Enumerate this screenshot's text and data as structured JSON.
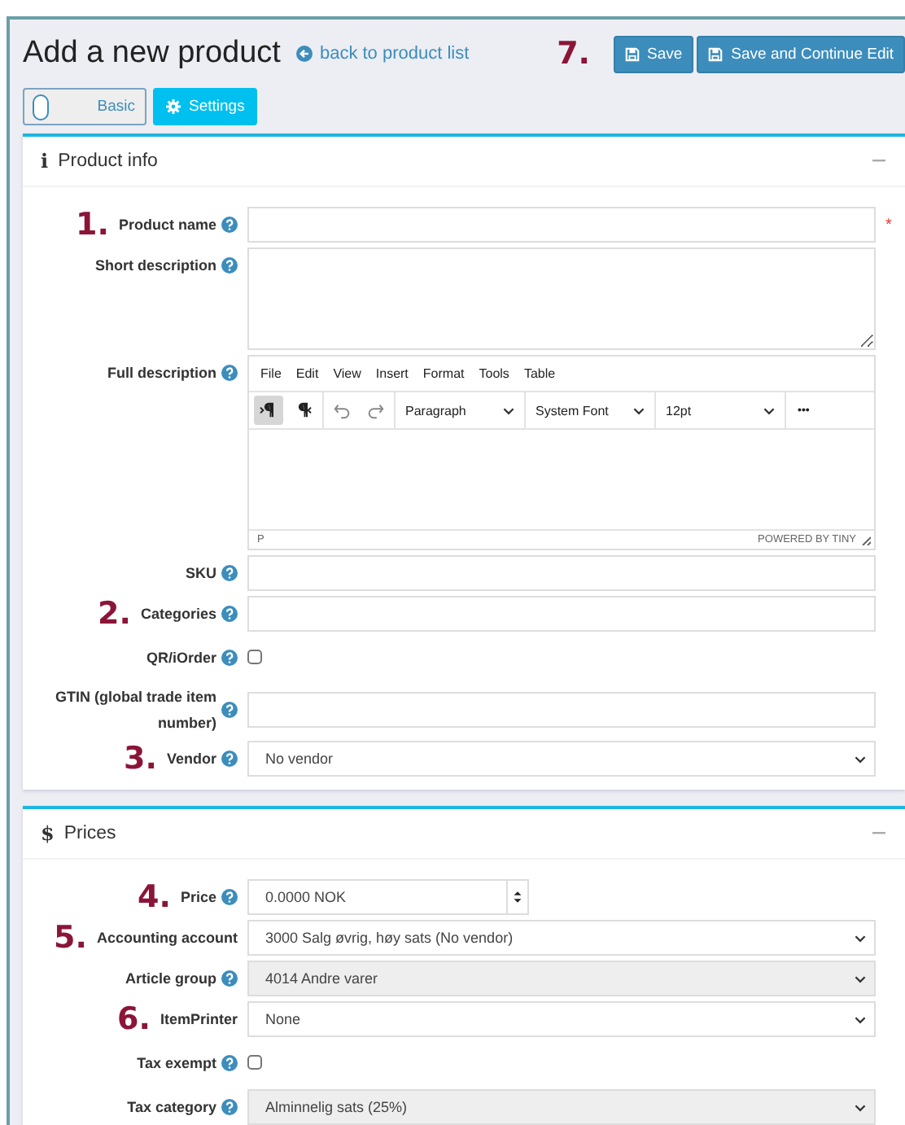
{
  "header": {
    "title": "Add a new product",
    "back_link": "back to product list",
    "marker": "7.",
    "buttons": [
      "Save",
      "Save and Continue Edit"
    ]
  },
  "mode_switch": {
    "label": "Basic",
    "on": false
  },
  "settings_button": "Settings",
  "sections": [
    {
      "icon": "i",
      "title": "Product info",
      "fields": [
        {
          "kind": "text",
          "label": "Product name",
          "marker": "1.",
          "help": true,
          "required_mark": "*"
        },
        {
          "kind": "textarea",
          "label": "Short description",
          "help": true
        },
        {
          "kind": "editor",
          "label": "Full description",
          "help": true,
          "menu": [
            "File",
            "Edit",
            "View",
            "Insert",
            "Format",
            "Tools",
            "Table"
          ],
          "direction_buttons": [
            {
              "selected": true
            },
            {
              "selected": false
            }
          ],
          "dropdowns": [
            "Paragraph",
            "System Font",
            "12pt"
          ],
          "more": "•••",
          "status_path": "P",
          "branding": "POWERED BY TINY"
        },
        {
          "kind": "text",
          "label": "SKU",
          "help": true
        },
        {
          "kind": "text",
          "label": "Categories",
          "marker": "2.",
          "help": true
        },
        {
          "kind": "checkbox",
          "label": "QR/iOrder",
          "help": true,
          "checked": false
        },
        {
          "kind": "text",
          "label": "GTIN (global trade item number)",
          "help": true
        },
        {
          "kind": "select",
          "label": "Vendor",
          "marker": "3.",
          "help": true,
          "value": "No vendor",
          "disabled": false
        }
      ]
    },
    {
      "icon": "$",
      "title": "Prices",
      "fields": [
        {
          "kind": "number",
          "label": "Price",
          "marker": "4.",
          "help": true,
          "value": "0.0000 NOK"
        },
        {
          "kind": "select",
          "label": "Accounting account",
          "marker": "5.",
          "help": false,
          "value": "3000 Salg øvrig, høy sats (No vendor)",
          "disabled": false
        },
        {
          "kind": "select",
          "label": "Article group",
          "help": true,
          "value": "4014 Andre varer",
          "disabled": true
        },
        {
          "kind": "select",
          "label": "ItemPrinter",
          "marker": "6.",
          "help": false,
          "value": "None",
          "disabled": false
        },
        {
          "kind": "checkbox",
          "label": "Tax exempt",
          "help": true,
          "checked": false
        },
        {
          "kind": "select",
          "label": "Tax category",
          "help": true,
          "value": "Alminnelig sats (25%)",
          "disabled": true
        }
      ]
    }
  ]
}
